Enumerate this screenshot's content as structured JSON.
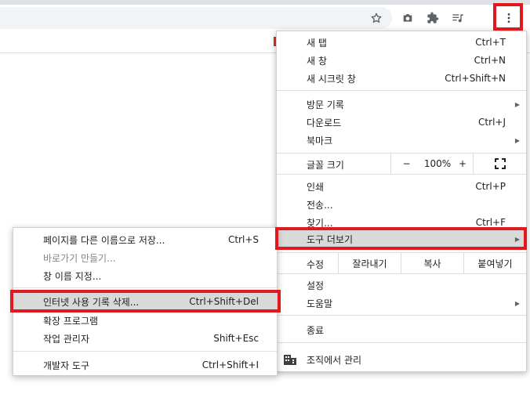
{
  "toolbar": {
    "star_icon": "star-icon",
    "camera_icon": "camera-icon",
    "extensions_icon": "puzzle-icon",
    "media_icon": "playlist-icon",
    "menu_icon": "kebab-icon"
  },
  "main_menu": {
    "new_tab": {
      "label": "새 탭",
      "shortcut": "Ctrl+T"
    },
    "new_window": {
      "label": "새 창",
      "shortcut": "Ctrl+N"
    },
    "new_incognito": {
      "label": "새 시크릿 창",
      "shortcut": "Ctrl+Shift+N"
    },
    "history": {
      "label": "방문 기록"
    },
    "downloads": {
      "label": "다운로드",
      "shortcut": "Ctrl+J"
    },
    "bookmarks": {
      "label": "북마크"
    },
    "zoom": {
      "label": "글꼴 크기",
      "minus": "−",
      "value": "100%",
      "plus": "+"
    },
    "print": {
      "label": "인쇄",
      "shortcut": "Ctrl+P"
    },
    "cast": {
      "label": "전송..."
    },
    "find": {
      "label": "찾기...",
      "shortcut": "Ctrl+F"
    },
    "more_tools": {
      "label": "도구 더보기"
    },
    "edit": {
      "label": "수정",
      "cut": "잘라내기",
      "copy": "복사",
      "paste": "붙여넣기"
    },
    "settings": {
      "label": "설정"
    },
    "help": {
      "label": "도움말"
    },
    "exit": {
      "label": "종료"
    },
    "managed": {
      "label": "조직에서 관리"
    }
  },
  "sub_menu": {
    "save_as": {
      "label": "페이지를 다른 이름으로 저장...",
      "shortcut": "Ctrl+S"
    },
    "create_shortcut": {
      "label": "바로가기 만들기..."
    },
    "name_window": {
      "label": "창 이름 지정..."
    },
    "clear_data": {
      "label": "인터넷 사용 기록 삭제...",
      "shortcut": "Ctrl+Shift+Del"
    },
    "extensions": {
      "label": "확장 프로그램"
    },
    "task_manager": {
      "label": "작업 관리자",
      "shortcut": "Shift+Esc"
    },
    "dev_tools": {
      "label": "개발자 도구",
      "shortcut": "Ctrl+Shift+I"
    }
  },
  "colors": {
    "highlight_box": "#e0181f",
    "hover_row": "#d9d9d9",
    "toolbar_bg": "#f1f3f4"
  }
}
